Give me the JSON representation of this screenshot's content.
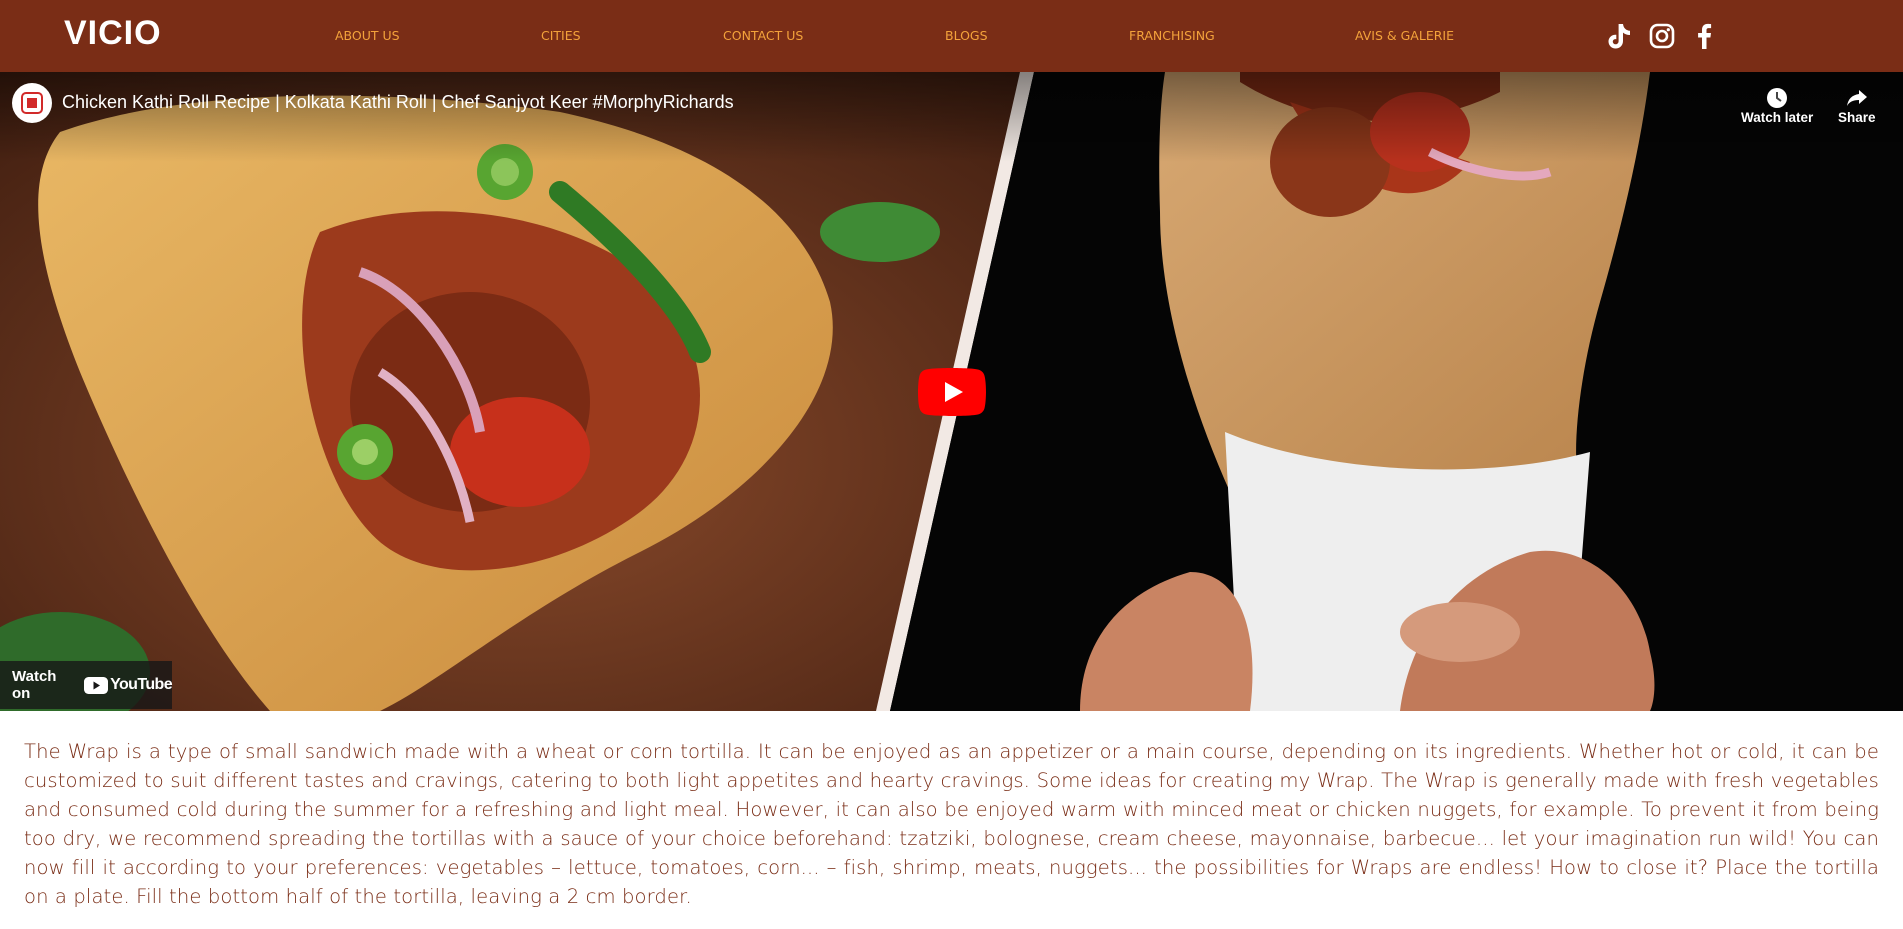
{
  "header": {
    "logo": "VICIO",
    "nav": [
      {
        "label": "ABOUT US"
      },
      {
        "label": "CITIES"
      },
      {
        "label": "CONTACT US"
      },
      {
        "label": "BLOGS"
      },
      {
        "label": "FRANCHISING"
      },
      {
        "label": "AVIS & GALERIE"
      }
    ],
    "social": [
      "tiktok-icon",
      "instagram-icon",
      "facebook-icon"
    ]
  },
  "video": {
    "title": "Chicken Kathi Roll Recipe | Kolkata Kathi Roll | Chef Sanjyot Keer #MorphyRichards",
    "watch_later": "Watch later",
    "share": "Share",
    "watch_on": "Watch on",
    "youtube": "YouTube"
  },
  "article": {
    "text": "The Wrap is a type of small sandwich made with a wheat or corn tortilla. It can be enjoyed as an appetizer or a main course, depending on its ingredients. Whether hot or cold, it can be customized to suit different tastes and cravings, catering to both light appetites and hearty cravings. Some ideas for creating my Wrap. The Wrap is generally made with fresh vegetables and consumed cold during the summer for a refreshing and light meal. However, it can also be enjoyed warm with minced meat or chicken nuggets, for example. To prevent it from being too dry, we recommend spreading the tortillas with a sauce of your choice beforehand: tzatziki, bolognese, cream cheese, mayonnaise, barbecue... let your imagination run wild! You can now fill it according to your preferences: vegetables – lettuce, tomatoes, corn... – fish, shrimp, meats, nuggets... the possibilities for Wraps are endless! How to close it? Place the tortilla on a plate. Fill the bottom half of the tortilla, leaving a 2 cm border."
  },
  "colors": {
    "header_bg": "#7a2d16",
    "nav_text": "#f3a23b",
    "body_text": "#7a2d16",
    "youtube_red": "#ff0000"
  }
}
